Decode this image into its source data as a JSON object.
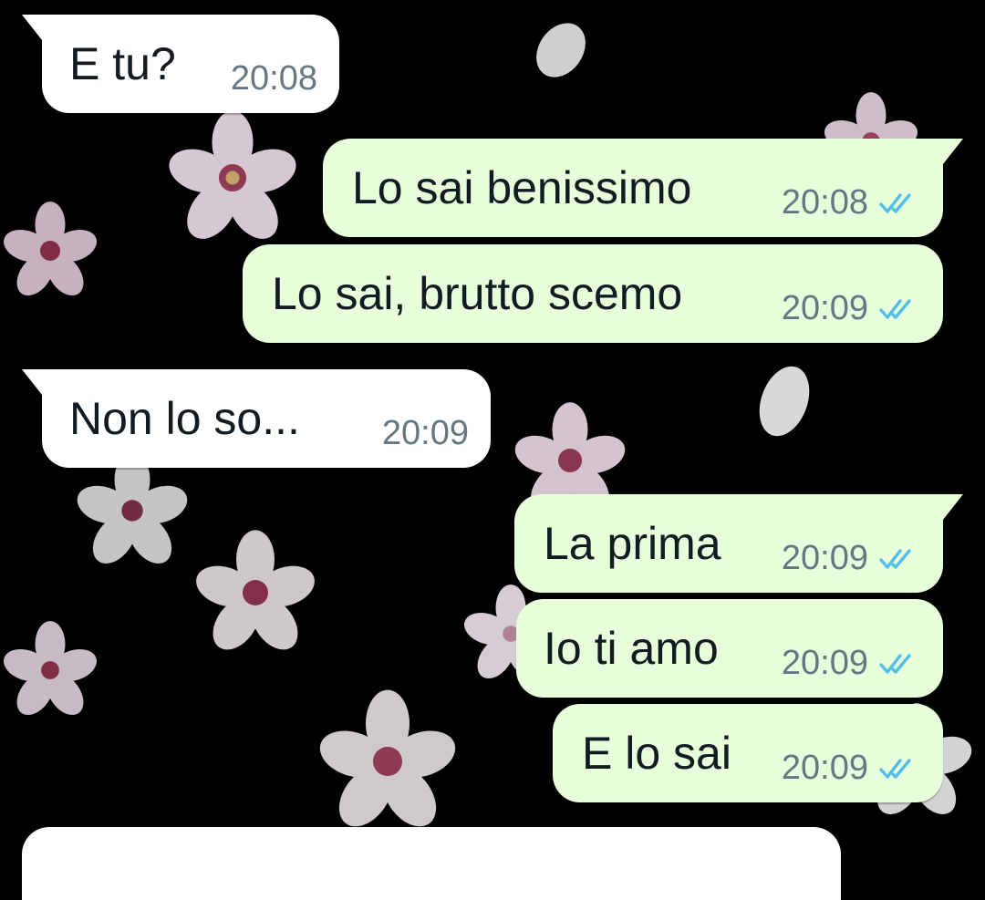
{
  "theme": {
    "incoming_bubble": "#ffffff",
    "outgoing_bubble": "#e7ffdb",
    "text_color": "#111b21",
    "time_color": "#667781",
    "read_receipt_color": "#53bdeb",
    "background": "#000000"
  },
  "messages": [
    {
      "direction": "incoming",
      "text": "E tu?",
      "time": "20:08"
    },
    {
      "direction": "outgoing",
      "text": "Lo sai benissimo",
      "time": "20:08",
      "status": "read"
    },
    {
      "direction": "outgoing",
      "text": "Lo sai, brutto scemo",
      "time": "20:09",
      "status": "read"
    },
    {
      "direction": "incoming",
      "text": "Non lo so...",
      "time": "20:09"
    },
    {
      "direction": "outgoing",
      "text": "La prima",
      "time": "20:09",
      "status": "read"
    },
    {
      "direction": "outgoing",
      "text": "Io ti amo",
      "time": "20:09",
      "status": "read"
    },
    {
      "direction": "outgoing",
      "text": "E lo sai",
      "time": "20:09",
      "status": "read"
    }
  ],
  "icons": {
    "read_receipt": "double-check-icon",
    "wallpaper": "cherry-blossom-wallpaper"
  }
}
